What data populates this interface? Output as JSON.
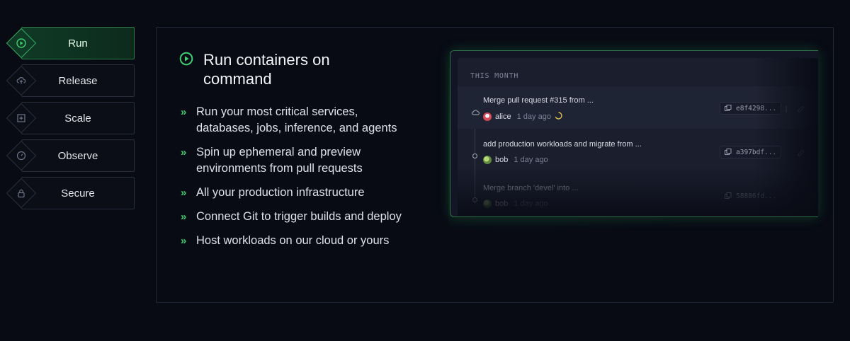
{
  "tabs": [
    {
      "label": "Run",
      "icon": "play-circle-icon",
      "active": true
    },
    {
      "label": "Release",
      "icon": "cloud-upload-icon",
      "active": false
    },
    {
      "label": "Scale",
      "icon": "plus-square-icon",
      "active": false
    },
    {
      "label": "Observe",
      "icon": "gauge-icon",
      "active": false
    },
    {
      "label": "Secure",
      "icon": "lock-icon",
      "active": false
    }
  ],
  "panel": {
    "title": "Run containers on command",
    "features": [
      "Run your most critical services, databases, jobs, inference, and agents",
      "Spin up ephemeral and preview environments from pull requests",
      "All your production infrastructure",
      "Connect Git to trigger builds and deploy",
      "Host workloads on our cloud or yours"
    ]
  },
  "commits": {
    "section_label": "THIS MONTH",
    "items": [
      {
        "message": "Merge pull request #315 from ...",
        "author": "alice",
        "time": "1 day ago",
        "sha": "e8f4298..."
      },
      {
        "message": "add production workloads and migrate from ...",
        "author": "bob",
        "time": "1 day ago",
        "sha": "a397bdf..."
      },
      {
        "message": "Merge branch 'devel' into ...",
        "author": "bob",
        "time": "1 day ago",
        "sha": "58886fd..."
      }
    ]
  },
  "colors": {
    "accent": "#3fce72",
    "background": "#080a14",
    "card": "#1a1e2d"
  }
}
